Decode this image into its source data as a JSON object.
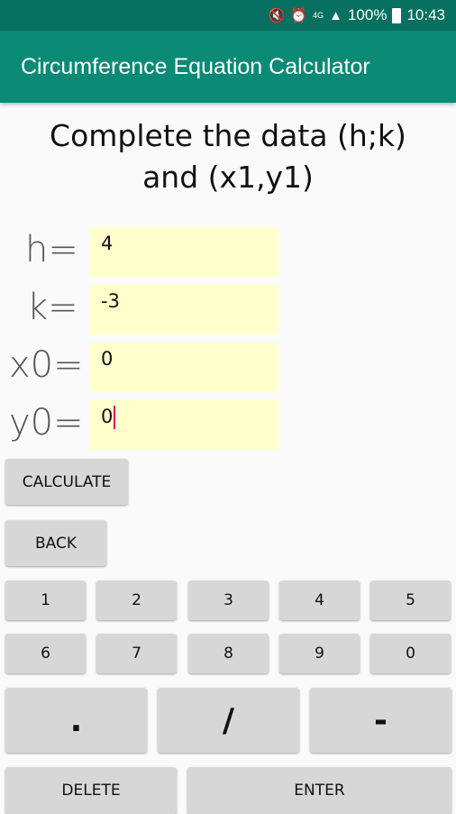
{
  "status_bar": {
    "battery": "100%",
    "time": "10:43",
    "network": "4G"
  },
  "app_bar": {
    "title": "Circumference Equation Calculator"
  },
  "heading": {
    "line1": "Complete the data (h;k)",
    "line2": "and (x1,y1)"
  },
  "fields": [
    {
      "label": "h=",
      "value": "4"
    },
    {
      "label": "k=",
      "value": "-3"
    },
    {
      "label": "x0=",
      "value": "0"
    },
    {
      "label": "y0=",
      "value": "0"
    }
  ],
  "buttons": {
    "calculate": "CALCULATE",
    "back": "BACK",
    "digits_row1": [
      "1",
      "2",
      "3",
      "4",
      "5"
    ],
    "digits_row2": [
      "6",
      "7",
      "8",
      "9",
      "0"
    ],
    "dot": ".",
    "slash": "/",
    "minus": "-",
    "delete": "DELETE",
    "enter": "ENTER"
  }
}
